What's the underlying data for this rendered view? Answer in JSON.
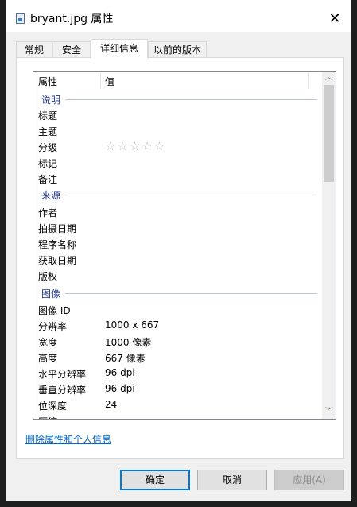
{
  "window": {
    "title": "bryant.jpg 属性",
    "close_glyph": "✕"
  },
  "tabs": [
    {
      "label": "常规",
      "active": false
    },
    {
      "label": "安全",
      "active": false
    },
    {
      "label": "详细信息",
      "active": true
    },
    {
      "label": "以前的版本",
      "active": false
    }
  ],
  "list": {
    "header": {
      "property": "属性",
      "value": "值"
    },
    "groups": {
      "description": "说明",
      "origin": "来源",
      "image": "图像"
    },
    "description_rows": [
      {
        "key": "标题",
        "value": ""
      },
      {
        "key": "主题",
        "value": ""
      },
      {
        "key": "分级",
        "value": ""
      },
      {
        "key": "标记",
        "value": ""
      },
      {
        "key": "备注",
        "value": ""
      }
    ],
    "rating": {
      "stars_text": "☆☆☆☆☆",
      "value": 0,
      "max": 5
    },
    "origin_rows": [
      {
        "key": "作者",
        "value": ""
      },
      {
        "key": "拍摄日期",
        "value": ""
      },
      {
        "key": "程序名称",
        "value": ""
      },
      {
        "key": "获取日期",
        "value": ""
      },
      {
        "key": "版权",
        "value": ""
      }
    ],
    "image_rows": [
      {
        "key": "图像 ID",
        "value": ""
      },
      {
        "key": "分辨率",
        "value": "1000 x 667"
      },
      {
        "key": "宽度",
        "value": "1000 像素"
      },
      {
        "key": "高度",
        "value": "667 像素"
      },
      {
        "key": "水平分辨率",
        "value": "96 dpi"
      },
      {
        "key": "垂直分辨率",
        "value": "96 dpi"
      },
      {
        "key": "位深度",
        "value": "24"
      },
      {
        "key": "压缩",
        "value": ""
      }
    ],
    "scroll_up_glyph": "︿",
    "scroll_down_glyph": "﹀"
  },
  "remove_link": "删除属性和个人信息",
  "buttons": {
    "ok": "确定",
    "cancel": "取消",
    "apply": "应用(A)"
  }
}
